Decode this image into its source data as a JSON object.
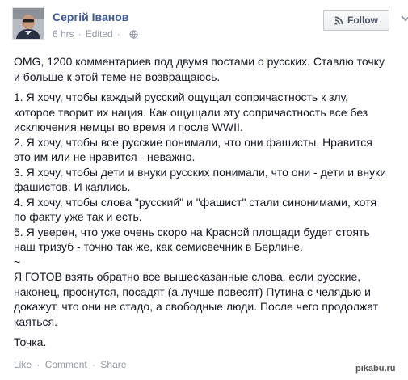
{
  "post": {
    "author": "Сергій Іванов",
    "time": "6 hrs",
    "edited": "Edited",
    "meta_sep": "·",
    "privacy_icon": "globe-icon",
    "follow_label": "Follow",
    "follow_icon": "rss-icon",
    "options_icon": "chevron-down-icon",
    "paragraphs": [
      {
        "lines": [
          "OMG, 1200 комментариев под двумя постами о русских. Ставлю точку",
          "и больше к этой теме не возвращаюсь."
        ]
      },
      {
        "lines": [
          "1. Я хочу, чтобы каждый русский ощущал сопричастность к злу,",
          "которое творит их нация. Как ощущали эту сопричастность все без",
          "исключения немцы во время и после WWII.",
          "2. Я хочу, чтобы все русские понимали, что они фашисты. Нравится",
          "это им или не нравится - неважно.",
          "3. Я хочу, чтобы дети и внуки русских понимали, что они - дети и внуки",
          "фашистов. И каялись.",
          "4. Я хочу, чтобы слова \"русский\" и \"фашист\" стали синонимами, хотя",
          "по факту уже так и есть.",
          "5. Я уверен, что уже очень скоро на Красной площади будет стоять",
          "наш тризуб - точно так же, как семисвечник в Берлине.",
          "~",
          "Я ГОТОВ взять обратно все вышесказанные слова, если русские,",
          "наконец, проснутся, посадят (а лучше повесят) Путина с челядью и",
          "докажут, что они не стадо, а свободные люди. После чего продолжат",
          "каяться."
        ]
      },
      {
        "lines": [
          "Точка."
        ]
      }
    ],
    "actions": {
      "like": "Like",
      "comment": "Comment",
      "share": "Share",
      "sep": "·"
    }
  },
  "watermark": "pikabu.ru",
  "colors": {
    "author": "#3b5998",
    "text": "#141823",
    "meta": "#9197a3"
  }
}
